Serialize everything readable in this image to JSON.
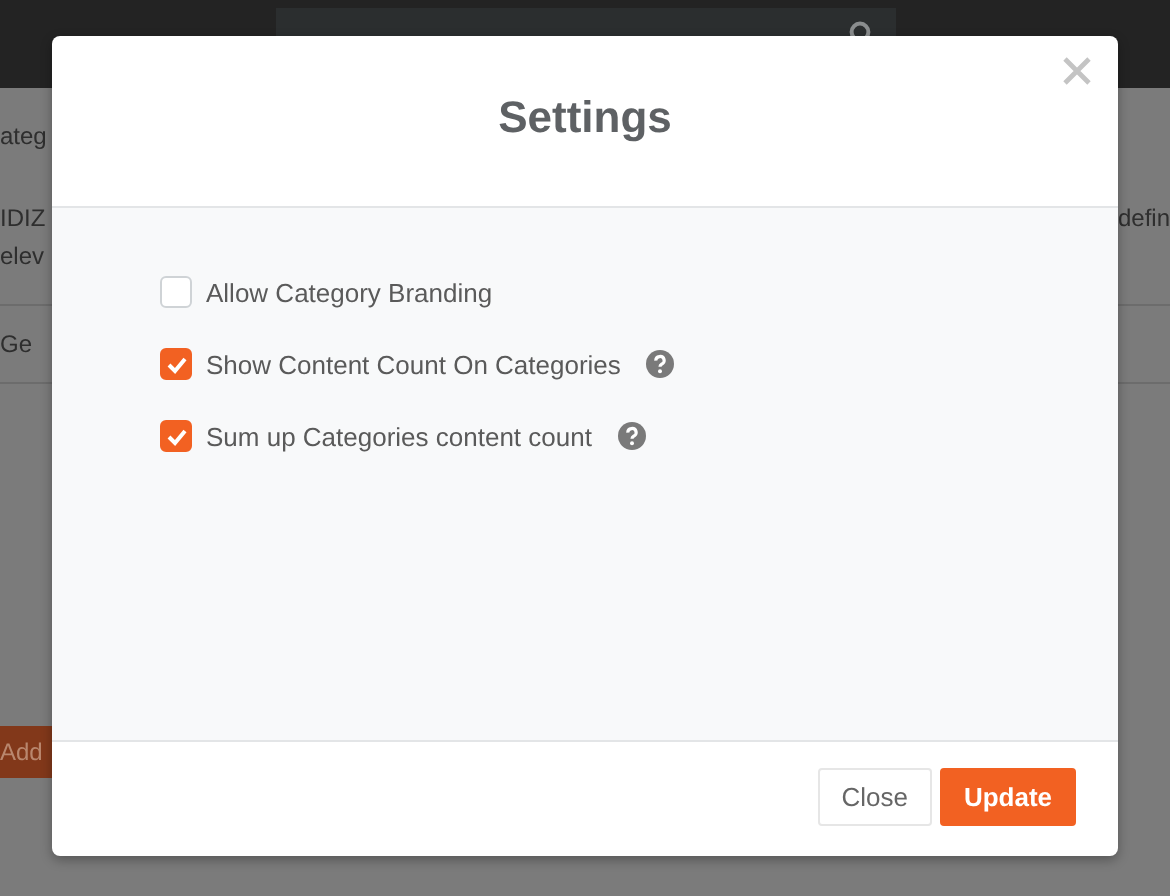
{
  "page_behind": {
    "heading": "ateg",
    "description_lines": [
      "IDIZ",
      "elev"
    ],
    "tab": "Ge",
    "add_button": "Add",
    "right_text": "defin"
  },
  "dialog": {
    "title": "Settings",
    "options": [
      {
        "label": "Allow Category Branding",
        "checked": false,
        "help": false
      },
      {
        "label": "Show Content Count On Categories",
        "checked": true,
        "help": true
      },
      {
        "label": "Sum up Categories content count",
        "checked": true,
        "help": true
      }
    ],
    "buttons": [
      {
        "label": "Close",
        "kind": "secondary"
      },
      {
        "label": "Update",
        "kind": "primary"
      }
    ]
  }
}
